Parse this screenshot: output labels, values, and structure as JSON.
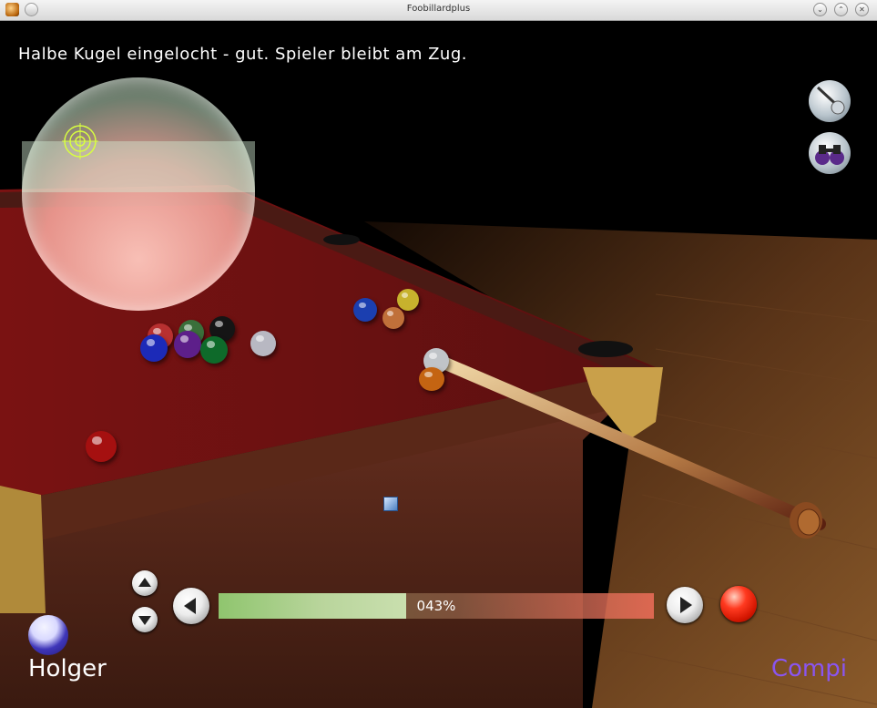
{
  "window": {
    "title": "Foobillardplus"
  },
  "status": {
    "message": "Halbe Kugel eingelocht - gut. Spieler bleibt am Zug."
  },
  "power": {
    "value": 0.43,
    "label": "043%"
  },
  "players": {
    "left": "Holger",
    "right": "Compi"
  },
  "colors": {
    "power_left": "#8fc56e",
    "power_right": "#f06e5a",
    "cloth": "#8a1818",
    "rail_wood": "#5a2818",
    "active_player": "#ffffff",
    "inactive_player": "#8a55f0"
  },
  "icons": {
    "app": "app-icon",
    "window_menu": "window-menu-icon",
    "minimize": "chevron-down-icon",
    "maximize": "chevron-up-icon",
    "close": "close-icon",
    "aim_mode": "cue-aim-icon",
    "view_mode": "binoculars-icon",
    "up": "arrow-up-icon",
    "down": "arrow-down-icon",
    "left": "arrow-left-icon",
    "right": "arrow-right-icon",
    "shoot": "red-shoot-icon",
    "player": "player-ball-icon",
    "crosshair": "crosshair-icon"
  }
}
